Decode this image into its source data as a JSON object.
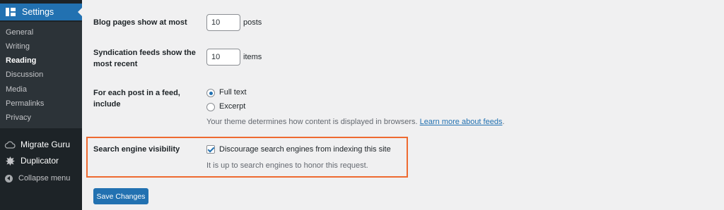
{
  "sidebar": {
    "section": {
      "label": "Settings",
      "icon": "settings-icon"
    },
    "items": [
      {
        "label": "General",
        "current": false
      },
      {
        "label": "Writing",
        "current": false
      },
      {
        "label": "Reading",
        "current": true
      },
      {
        "label": "Discussion",
        "current": false
      },
      {
        "label": "Media",
        "current": false
      },
      {
        "label": "Permalinks",
        "current": false
      },
      {
        "label": "Privacy",
        "current": false
      }
    ],
    "plugins": [
      {
        "label": "Migrate Guru",
        "icon": "cloud-icon"
      },
      {
        "label": "Duplicator",
        "icon": "duplicator-icon"
      }
    ],
    "collapse": {
      "label": "Collapse menu",
      "icon": "collapse-arrow-icon"
    }
  },
  "form": {
    "blog_pages": {
      "label": "Blog pages show at most",
      "value": "10",
      "unit": "posts"
    },
    "syndication": {
      "label": "Syndication feeds show the most recent",
      "value": "10",
      "unit": "items"
    },
    "feed_include": {
      "label": "For each post in a feed, include",
      "options": [
        {
          "label": "Full text",
          "selected": true
        },
        {
          "label": "Excerpt",
          "selected": false
        }
      ],
      "description": "Your theme determines how content is displayed in browsers.",
      "link_text": "Learn more about feeds",
      "link_suffix": "."
    },
    "search_visibility": {
      "label": "Search engine visibility",
      "checkbox_label": "Discourage search engines from indexing this site",
      "checked": true,
      "description": "It is up to search engines to honor this request."
    },
    "save_label": "Save Changes"
  },
  "colors": {
    "accent": "#2271b1",
    "sidebar_bg": "#1d2327",
    "highlight_border": "#ee6a30"
  }
}
